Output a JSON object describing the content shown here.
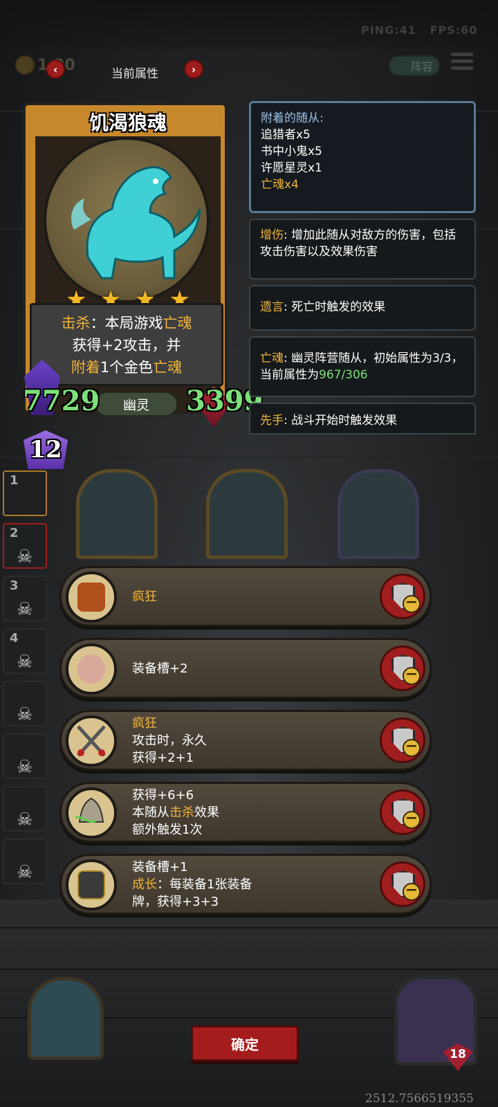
{
  "hud": {
    "ping": "PING:41",
    "fps": "FPS:60",
    "gold": "1:20",
    "roster_label": "阵容"
  },
  "header": {
    "title": "当前属性",
    "prev_icon": "chevron-left-icon",
    "next_icon": "chevron-right-icon"
  },
  "card": {
    "name": "饥渴狼魂",
    "stars": 4,
    "desc_line1_kw": "击杀",
    "desc_line1_rest": "：本局游戏",
    "desc_line1_hl": "亡魂",
    "desc_line2": "获得+2攻击，并",
    "desc_line3_kw": "附着",
    "desc_line3_mid": "1个金色",
    "desc_line3_hl": "亡魂",
    "attack": "7729",
    "health": "3399",
    "tribe": "幽灵"
  },
  "info": {
    "minions_header": "附着的随从:",
    "minions": [
      "追猎者x5",
      "书中小鬼x5",
      "许愿星灵x1"
    ],
    "minions_gold": "亡魂x4",
    "dmg_kw": "增伤",
    "dmg_text": ": 增加此随从对敌方的伤害，包括攻击伤害以及效果伤害",
    "deathrattle_kw": "遗言",
    "deathrattle_text": ": 死亡时触发的效果",
    "soul_kw": "亡魂",
    "soul_text": ": 幽灵阵营随从，初始属性为3/3，当前属性为",
    "soul_value": "967/306",
    "first_kw": "先手",
    "first_text": ": 战斗开始时触发效果"
  },
  "level": "12",
  "slots": [
    "1",
    "2",
    "3",
    "4"
  ],
  "items": [
    {
      "lines": [
        {
          "kw": "疯狂",
          "rest": ""
        }
      ],
      "icon": "helmet-icon"
    },
    {
      "lines": [
        {
          "kw": "",
          "rest": "装备槽+2"
        }
      ],
      "icon": "pig-armor-icon"
    },
    {
      "lines": [
        {
          "kw": "疯狂",
          "rest": ""
        },
        {
          "kw": "",
          "rest": "攻击时，永久"
        },
        {
          "kw": "",
          "rest": "获得+2+1"
        }
      ],
      "icon": "crossed-swords-icon"
    },
    {
      "lines": [
        {
          "kw": "",
          "rest": "获得+6+6"
        },
        {
          "kw": "",
          "rest": "本随从",
          "kw2": "击杀",
          "rest2": "效果"
        },
        {
          "kw": "",
          "rest": "额外触发1次"
        }
      ],
      "icon": "bell-icon"
    },
    {
      "lines": [
        {
          "kw": "",
          "rest": "装备槽+1"
        },
        {
          "kw": "成长",
          "rest": "：每装备1张装备"
        },
        {
          "kw": "",
          "rest": "牌，获得+3+3"
        }
      ],
      "icon": "gauntlet-icon"
    }
  ],
  "confirm_label": "确定",
  "hero_hp": "18",
  "coords": "2512.7566519355"
}
